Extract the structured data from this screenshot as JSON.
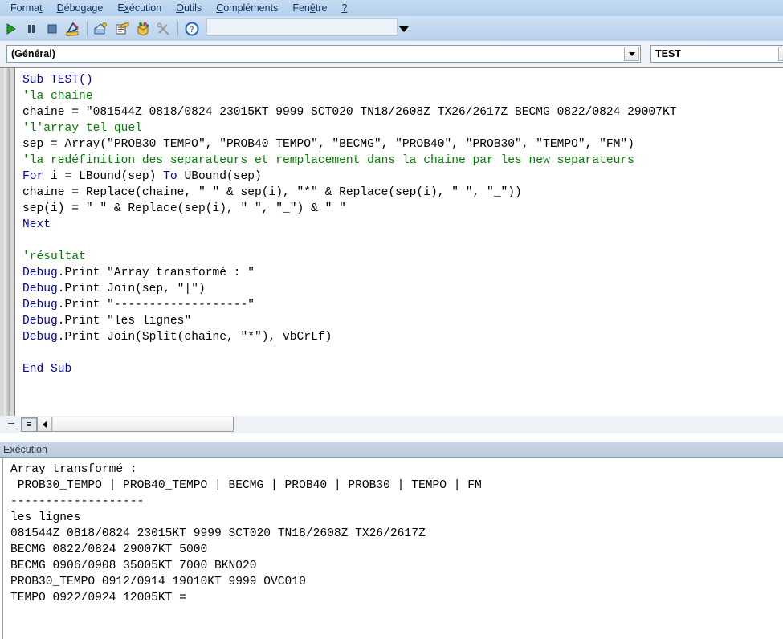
{
  "menubar": {
    "items": [
      {
        "name": "menu-format",
        "pre": "Forma",
        "accel": "t",
        "post": ""
      },
      {
        "name": "menu-debogage",
        "pre": "",
        "accel": "D",
        "post": "ébogage"
      },
      {
        "name": "menu-execution",
        "pre": "E",
        "accel": "x",
        "post": "écution"
      },
      {
        "name": "menu-outils",
        "pre": "",
        "accel": "O",
        "post": "utils"
      },
      {
        "name": "menu-complements",
        "pre": "",
        "accel": "C",
        "post": "ompléments"
      },
      {
        "name": "menu-fenetre",
        "pre": "Fen",
        "accel": "ê",
        "post": "tre"
      },
      {
        "name": "menu-aide",
        "pre": "",
        "accel": "?",
        "post": ""
      }
    ]
  },
  "toolbar": {
    "buttons": [
      {
        "name": "run-button",
        "icon": "run-icon",
        "tooltip": "Exécuter"
      },
      {
        "name": "pause-button",
        "icon": "pause-icon",
        "tooltip": "Interrompre"
      },
      {
        "name": "stop-button",
        "icon": "stop-icon",
        "tooltip": "Réinitialiser"
      },
      {
        "name": "design-mode-button",
        "icon": "design-mode-icon",
        "tooltip": "Mode création"
      },
      {
        "name": "project-explorer-button",
        "icon": "project-explorer-icon",
        "tooltip": "Explorateur de projet"
      },
      {
        "name": "properties-window-button",
        "icon": "properties-window-icon",
        "tooltip": "Fenêtre Propriétés"
      },
      {
        "name": "object-browser-button",
        "icon": "object-browser-icon",
        "tooltip": "Explorateur d'objets"
      },
      {
        "name": "toolbox-button",
        "icon": "toolbox-icon",
        "tooltip": "Boîte à outils"
      },
      {
        "name": "help-button",
        "icon": "help-icon",
        "tooltip": "Aide"
      }
    ],
    "overflow_icon": "toolbar-overflow-icon"
  },
  "combos": {
    "object": {
      "value": "(Général)",
      "arrow_icon": "chevron-down-icon"
    },
    "procedure": {
      "value": "TEST",
      "arrow_icon": "chevron-down-icon"
    }
  },
  "code": {
    "lines": [
      [
        {
          "t": "Sub TEST()",
          "c": "kw-plain"
        }
      ],
      [
        {
          "t": "'la chaine",
          "c": "cmt"
        }
      ],
      [
        {
          "t": "chaine = \"081544Z 0818/0824 23015KT 9999 SCT020 TN18/2608Z TX26/2617Z BECMG 0822/0824 29007KT",
          "c": "plain"
        }
      ],
      [
        {
          "t": "'l'array tel quel",
          "c": "cmt"
        }
      ],
      [
        {
          "t": "sep = Array(\"PROB30 TEMPO\", \"PROB40 TEMPO\", \"BECMG\", \"PROB40\", \"PROB30\", \"TEMPO\", \"FM\")",
          "c": "plain"
        }
      ],
      [
        {
          "t": "'la redéfinition des separateurs et remplacement dans la chaine par les new separateurs",
          "c": "cmt"
        }
      ],
      [
        {
          "t": "For",
          "c": "kw"
        },
        {
          "t": " i = LBound(sep) ",
          "c": "plain"
        },
        {
          "t": "To",
          "c": "kw"
        },
        {
          "t": " UBound(sep)",
          "c": "plain"
        }
      ],
      [
        {
          "t": "chaine = Replace(chaine, \" \" & sep(i), \"*\" & Replace(sep(i), \" \", \"_\"))",
          "c": "plain"
        }
      ],
      [
        {
          "t": "sep(i) = \" \" & Replace(sep(i), \" \", \"_\") & \" \"",
          "c": "plain"
        }
      ],
      [
        {
          "t": "Next",
          "c": "kw"
        }
      ],
      [
        {
          "t": "",
          "c": "plain"
        }
      ],
      [
        {
          "t": "'résultat",
          "c": "cmt"
        }
      ],
      [
        {
          "t": "Debug",
          "c": "kw"
        },
        {
          "t": ".Print \"Array transformé : \"",
          "c": "plain"
        }
      ],
      [
        {
          "t": "Debug",
          "c": "kw"
        },
        {
          "t": ".Print Join(sep, \"|\")",
          "c": "plain"
        }
      ],
      [
        {
          "t": "Debug",
          "c": "kw"
        },
        {
          "t": ".Print \"-------------------\"",
          "c": "plain"
        }
      ],
      [
        {
          "t": "Debug",
          "c": "kw"
        },
        {
          "t": ".Print \"les lignes\"",
          "c": "plain"
        }
      ],
      [
        {
          "t": "Debug",
          "c": "kw"
        },
        {
          "t": ".Print Join(Split(chaine, \"*\"), vbCrLf)",
          "c": "plain"
        }
      ],
      [
        {
          "t": "",
          "c": "plain"
        }
      ],
      [
        {
          "t": "End Sub",
          "c": "kw-plain"
        }
      ]
    ]
  },
  "code_bottom": {
    "procedure_view_label": "═",
    "full_module_view_label": "≡",
    "scroll_left_icon": "scroll-left-arrow-icon"
  },
  "immediate": {
    "title": "Exécution",
    "lines": [
      "Array transformé : ",
      " PROB30_TEMPO | PROB40_TEMPO | BECMG | PROB40 | PROB30 | TEMPO | FM",
      "-------------------",
      "les lignes",
      "081544Z 0818/0824 23015KT 9999 SCT020 TN18/2608Z TX26/2617Z",
      "BECMG 0822/0824 29007KT 5000",
      "BECMG 0906/0908 35005KT 7000 BKN020",
      "PROB30_TEMPO 0912/0914 19010KT 9999 OVC010",
      "TEMPO 0922/0924 12005KT ="
    ]
  },
  "colors": {
    "comment_green": "#008000",
    "keyword_blue": "#0000b0",
    "menubar_blue": "#bdd6ef",
    "pane_title_blue": "#c2cfdc"
  }
}
